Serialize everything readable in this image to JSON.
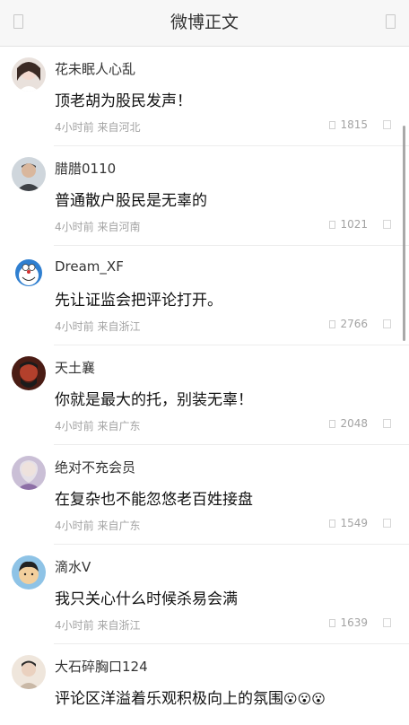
{
  "header": {
    "title": "微博正文"
  },
  "comments": [
    {
      "user": "花未眠人心乱",
      "text": "顶老胡为股民发声！",
      "meta": "4小时前 来自河北",
      "likes": "1815"
    },
    {
      "user": "腊腊0110",
      "text": "普通散户股民是无辜的",
      "meta": "4小时前 来自河南",
      "likes": "1021"
    },
    {
      "user": "Dream_XF",
      "text": "先让证监会把评论打开。",
      "meta": "4小时前 来自浙江",
      "likes": "2766"
    },
    {
      "user": "天土襄",
      "text": "你就是最大的托，别装无辜！",
      "meta": "4小时前 来自广东",
      "likes": "2048"
    },
    {
      "user": "绝对不充会员",
      "text": "在复杂也不能忽悠老百姓接盘",
      "meta": "4小时前 来自广东",
      "likes": "1549"
    },
    {
      "user": "滴水V",
      "text": "我只关心什么时候杀易会满",
      "meta": "4小时前 来自浙江",
      "likes": "1639"
    },
    {
      "user": "大石碎胸口124",
      "text": "评论区洋溢着乐观积极向上的氛围",
      "emoji": "😮😮😮"
    }
  ]
}
